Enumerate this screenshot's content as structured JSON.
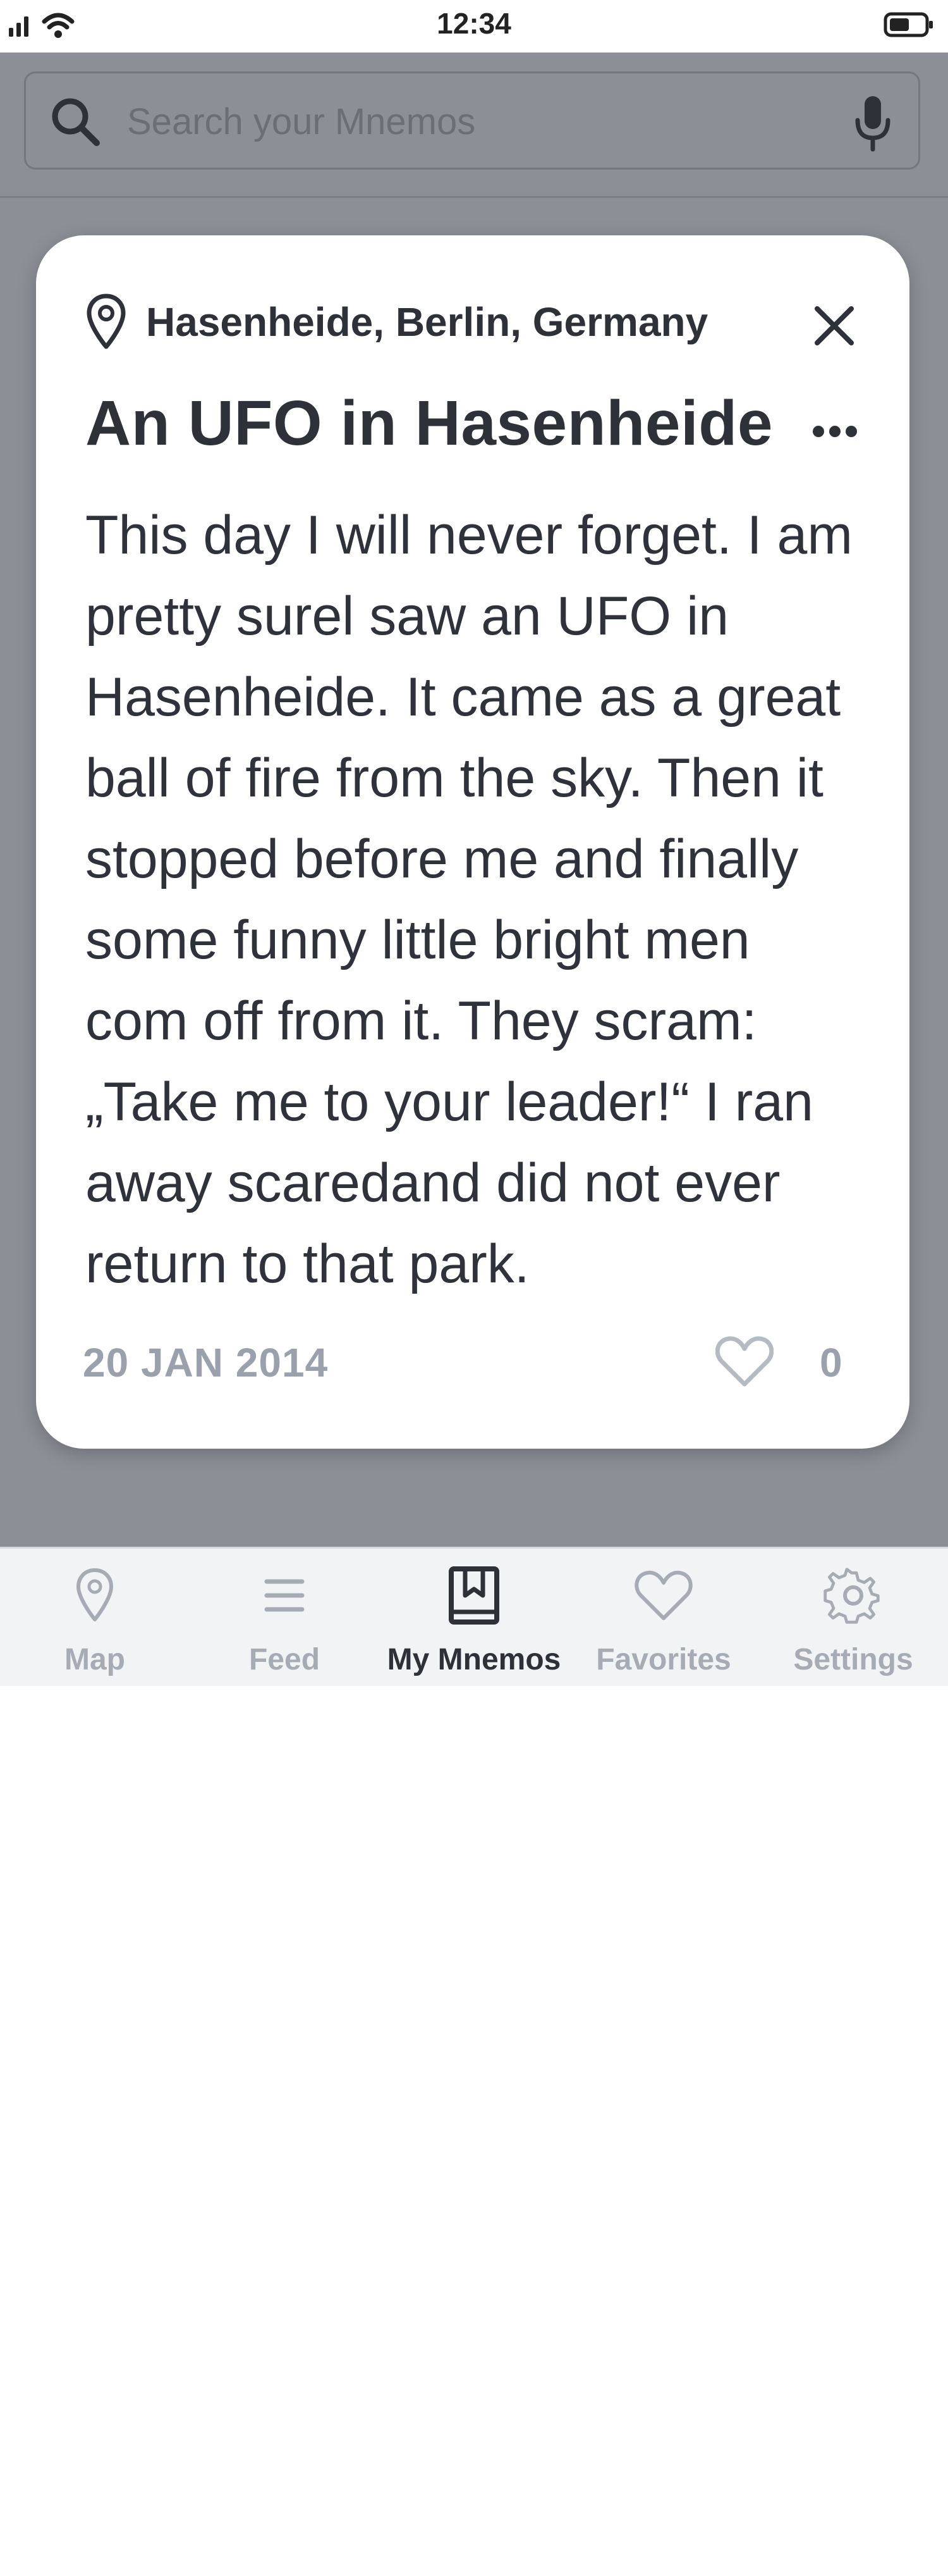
{
  "status_bar": {
    "time": "12:34"
  },
  "search": {
    "placeholder": "Search your Mnemos"
  },
  "mnemo": {
    "location": "Hasenheide, Berlin, Germany",
    "title": "An UFO in Hasenheide",
    "body": "This day I will never forget. I am pretty surel saw an UFO in Hasenheide. It came as a great ball of fire from the sky. Then it stopped before me and finally some funny little bright men com off from it. They scram: „Take me to your leader!“ I ran away scaredand did not ever return to that park.",
    "date": "20 JAN 2014",
    "like_count": "0"
  },
  "tabs": [
    {
      "label": "Map",
      "icon": "map-pin-icon",
      "active": false
    },
    {
      "label": "Feed",
      "icon": "feed-lines-icon",
      "active": false
    },
    {
      "label": "My Mnemos",
      "icon": "book-icon",
      "active": true
    },
    {
      "label": "Favorites",
      "icon": "heart-icon",
      "active": false
    },
    {
      "label": "Settings",
      "icon": "gear-icon",
      "active": false
    }
  ],
  "colors": {
    "overlay": "#8c8f96",
    "text_dark": "#2e3138",
    "text_muted": "#9aa1ad",
    "tab_inactive": "#a7abb3"
  }
}
